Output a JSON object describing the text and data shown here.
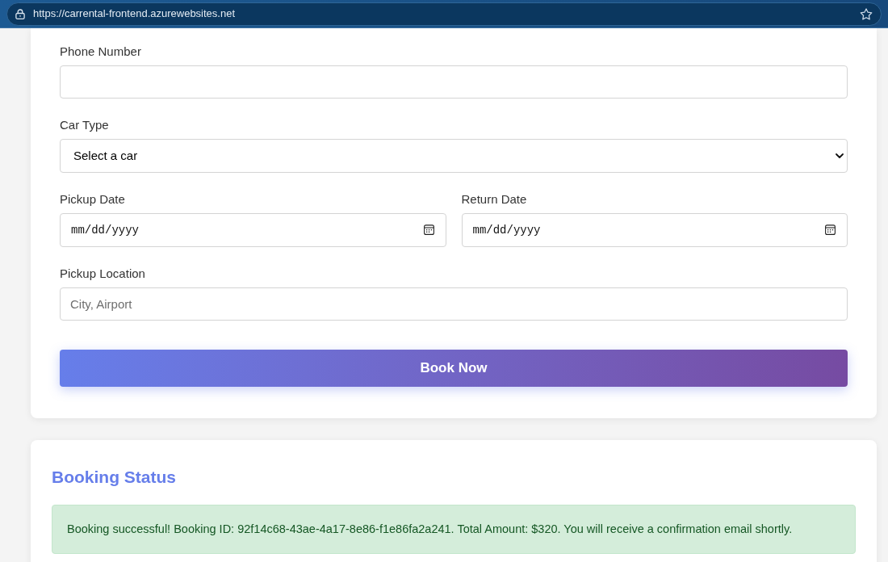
{
  "browser": {
    "url": "https://carrental-frontend.azurewebsites.net"
  },
  "booking_form": {
    "rows": [
      [
        {
          "kind": "text",
          "label": "Phone Number"
        }
      ],
      [
        {
          "kind": "select",
          "label": "Car Type",
          "value": "Select a car"
        }
      ],
      [
        {
          "kind": "date",
          "label": "Pickup Date",
          "placeholder": "mm/dd/yyyy"
        },
        {
          "kind": "date",
          "label": "Return Date",
          "placeholder": "mm/dd/yyyy"
        }
      ],
      [
        {
          "kind": "text",
          "label": "Pickup Location",
          "placeholder": "City, Airport"
        }
      ]
    ],
    "submit_button": {
      "label": "Book Now"
    }
  },
  "booking_status": {
    "title": "Booking Status",
    "message": {
      "kind": "success",
      "text": "Booking successful! Booking ID: 92f14c68-43ae-4a17-8e86-f1e86fa2a241. Total Amount: $320. You will receive a confirmation email shortly."
    }
  }
}
